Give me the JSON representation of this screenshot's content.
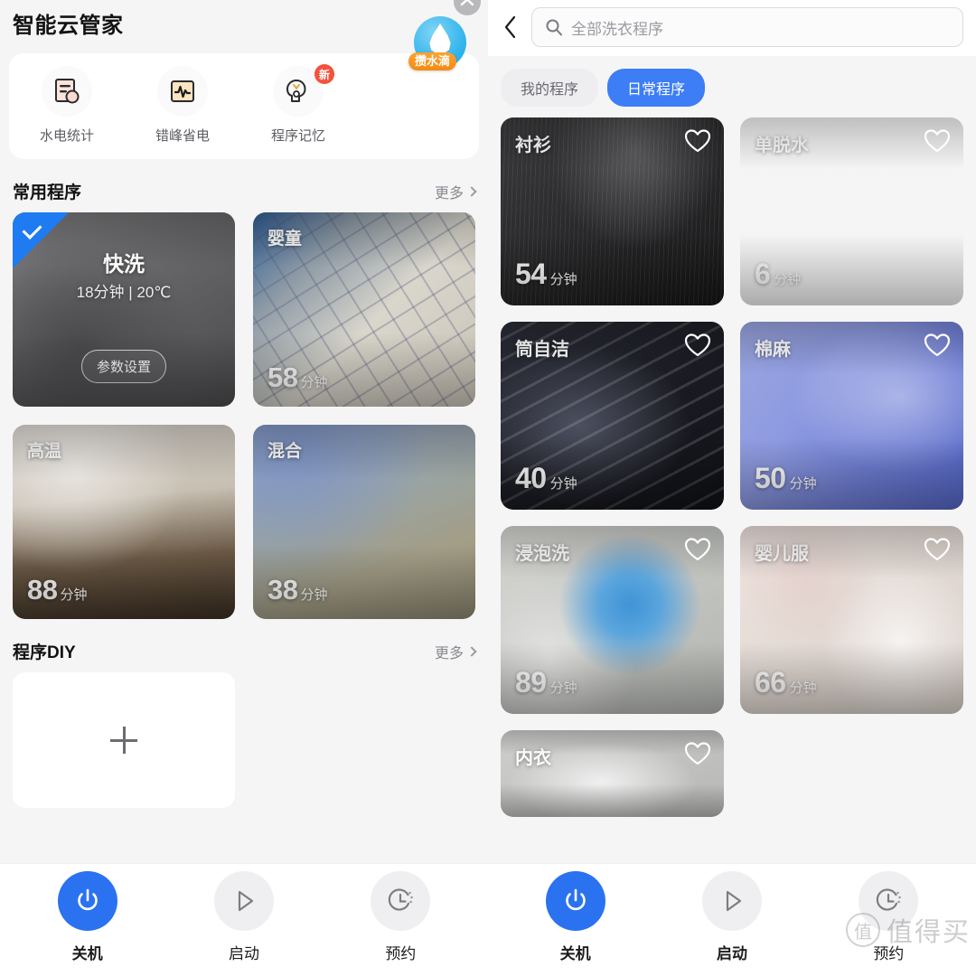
{
  "left": {
    "app_title": "智能云管家",
    "drop_badge": {
      "label": "攒水滴",
      "icon": "water-drop-icon"
    },
    "collapse_icon": "chevron-up-icon",
    "quick_actions": [
      {
        "label": "水电统计",
        "icon": "utility-stats-icon",
        "badge": ""
      },
      {
        "label": "错峰省电",
        "icon": "power-waveform-icon",
        "badge": ""
      },
      {
        "label": "程序记忆",
        "icon": "brain-memory-icon",
        "badge": "新"
      }
    ],
    "sections": [
      {
        "title": "常用程序",
        "more": "更多"
      },
      {
        "title": "程序DIY",
        "more": "更多"
      }
    ],
    "programs": [
      {
        "name": "快洗",
        "minutes": "18",
        "unit": "分钟",
        "subtitle": "18分钟 | 20℃",
        "param_button": "参数设置",
        "selected": true,
        "bg": "bg-kuaixi"
      },
      {
        "name": "婴童",
        "minutes": "58",
        "unit": "分钟",
        "selected": false,
        "bg": "bg-yingtong"
      },
      {
        "name": "高温",
        "minutes": "88",
        "unit": "分钟",
        "selected": false,
        "bg": "bg-gaowen"
      },
      {
        "name": "混合",
        "minutes": "38",
        "unit": "分钟",
        "selected": false,
        "bg": "bg-hunhe"
      }
    ],
    "diy_add_icon": "plus-icon"
  },
  "right": {
    "back_icon": "back-chevron-icon",
    "search": {
      "placeholder": "全部洗衣程序",
      "value": "",
      "icon": "search-icon"
    },
    "tabs": [
      {
        "label": "我的程序",
        "active": false
      },
      {
        "label": "日常程序",
        "active": true
      }
    ],
    "programs": [
      {
        "name": "衬衫",
        "minutes": "54",
        "unit": "分钟",
        "favorite": false,
        "bg": "bg-chenshan"
      },
      {
        "name": "单脱水",
        "minutes": "6",
        "unit": "分钟",
        "favorite": false,
        "bg": "bg-tuoshui"
      },
      {
        "name": "筒自洁",
        "minutes": "40",
        "unit": "分钟",
        "favorite": false,
        "bg": "bg-zijie"
      },
      {
        "name": "棉麻",
        "minutes": "50",
        "unit": "分钟",
        "favorite": false,
        "bg": "bg-mianma"
      },
      {
        "name": "浸泡洗",
        "minutes": "89",
        "unit": "分钟",
        "favorite": false,
        "bg": "bg-jinpao"
      },
      {
        "name": "婴儿服",
        "minutes": "66",
        "unit": "分钟",
        "favorite": false,
        "bg": "bg-yinger"
      },
      {
        "name": "内衣",
        "minutes": "",
        "unit": "",
        "favorite": false,
        "bg": "bg-neiyi",
        "clipped": true
      }
    ]
  },
  "bottom_bar": {
    "items": [
      {
        "label": "关机",
        "icon": "power-icon",
        "active": true
      },
      {
        "label": "启动",
        "icon": "play-icon",
        "active": false
      },
      {
        "label": "预约",
        "icon": "timer-icon",
        "active": false
      }
    ]
  },
  "watermark": {
    "mark": "值",
    "text": "值得买"
  },
  "colors": {
    "accent_blue": "#3d7df5",
    "power_blue": "#2a72f0",
    "badge_red": "#f3523b",
    "badge_orange": "#f38a14",
    "page_bg": "#f5f5f6",
    "card_bg": "#ffffff"
  }
}
